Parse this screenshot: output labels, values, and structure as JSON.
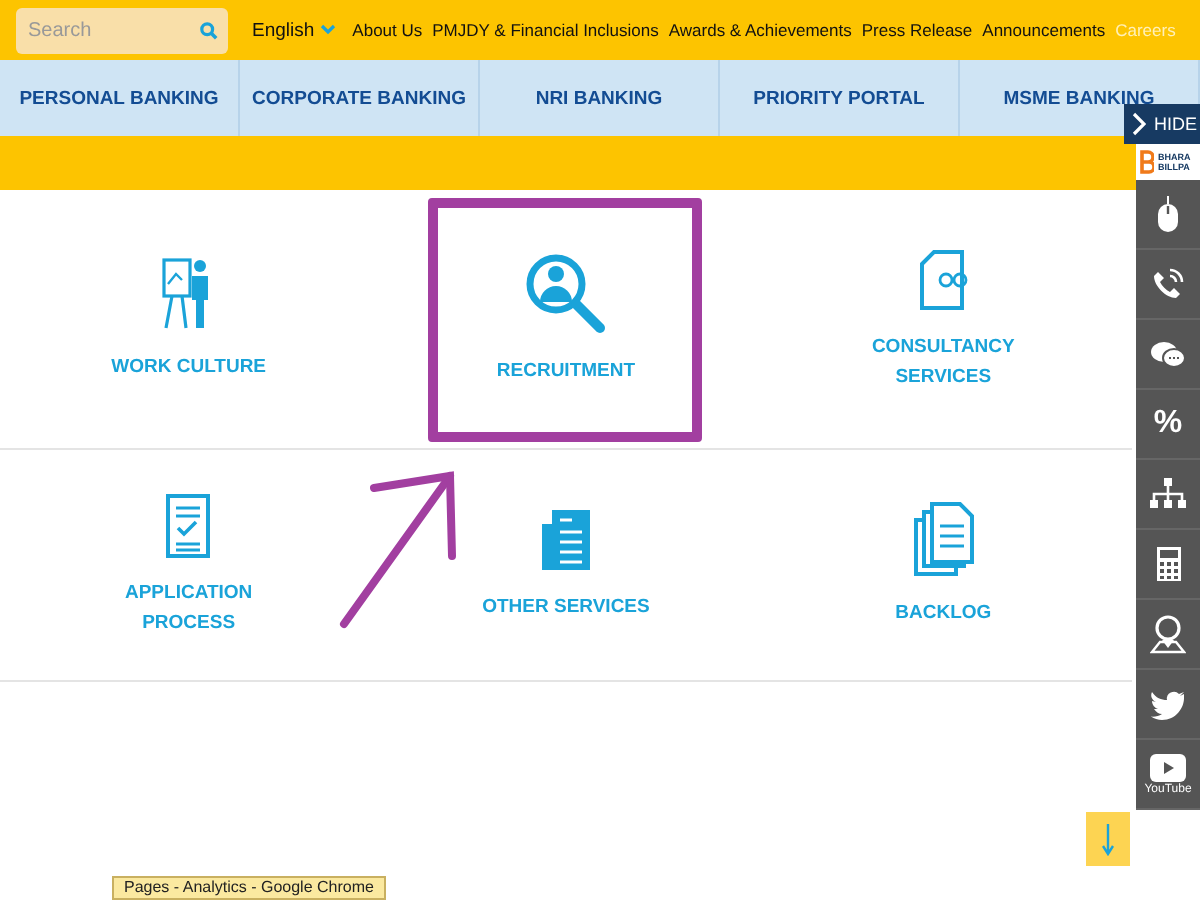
{
  "top_bar": {
    "search": {
      "placeholder": "Search"
    },
    "language": "English",
    "links": [
      {
        "label": "About Us",
        "selected": false
      },
      {
        "label": "PMJDY & Financial Inclusions",
        "selected": false
      },
      {
        "label": "Awards & Achievements",
        "selected": false
      },
      {
        "label": "Press Release",
        "selected": false
      },
      {
        "label": "Announcements",
        "selected": false
      },
      {
        "label": "Careers",
        "selected": true
      }
    ]
  },
  "nav": [
    "PERSONAL BANKING",
    "CORPORATE BANKING",
    "NRI BANKING",
    "PRIORITY PORTAL",
    "MSME BANKING"
  ],
  "tiles": [
    {
      "kind": "easel",
      "lines": [
        "WORK CULTURE"
      ],
      "highlighted": false
    },
    {
      "kind": "magnifier",
      "lines": [
        "RECRUITMENT"
      ],
      "highlighted": true
    },
    {
      "kind": "document",
      "lines": [
        "CONSULTANCY",
        "SERVICES"
      ],
      "highlighted": false
    },
    {
      "kind": "checklist",
      "lines": [
        "APPLICATION",
        "PROCESS"
      ],
      "highlighted": false
    },
    {
      "kind": "newspaper",
      "lines": [
        "OTHER SERVICES"
      ],
      "highlighted": false
    },
    {
      "kind": "stack",
      "lines": [
        "BACKLOG"
      ],
      "highlighted": false
    }
  ],
  "side_panel": {
    "hide_label": "HIDE",
    "billpay": [
      "BHARA",
      "BILLPA"
    ],
    "items": [
      {
        "kind": "mouse"
      },
      {
        "kind": "phone"
      },
      {
        "kind": "chat"
      },
      {
        "kind": "percent",
        "symbol": "%"
      },
      {
        "kind": "sitemap"
      },
      {
        "kind": "calculator"
      },
      {
        "kind": "locator"
      },
      {
        "kind": "bird"
      },
      {
        "kind": "play",
        "label": "YouTube"
      }
    ]
  },
  "tooltip": "Pages - Analytics - Google Chrome"
}
